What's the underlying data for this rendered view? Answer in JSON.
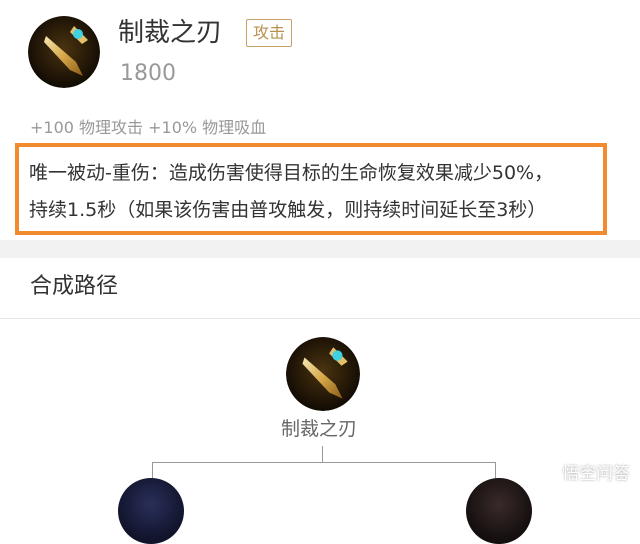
{
  "item": {
    "name": "制裁之刃",
    "tag": "攻击",
    "price": "1800",
    "stats": "+100 物理攻击 +10% 物理吸血",
    "passive_line1": "唯一被动-重伤：造成伤害使得目标的生命恢复效果减少50%，",
    "passive_line2": "持续1.5秒（如果该伤害由普攻触发，则持续时间延长至3秒）",
    "icon": "sword-icon"
  },
  "recipe": {
    "title": "合成路径",
    "root_label": "制裁之刃"
  },
  "watermark": {
    "text": "悟空问答"
  },
  "colors": {
    "highlight_border": "#f28b2d",
    "tag_border": "#c6a267",
    "muted_text": "#999999"
  }
}
